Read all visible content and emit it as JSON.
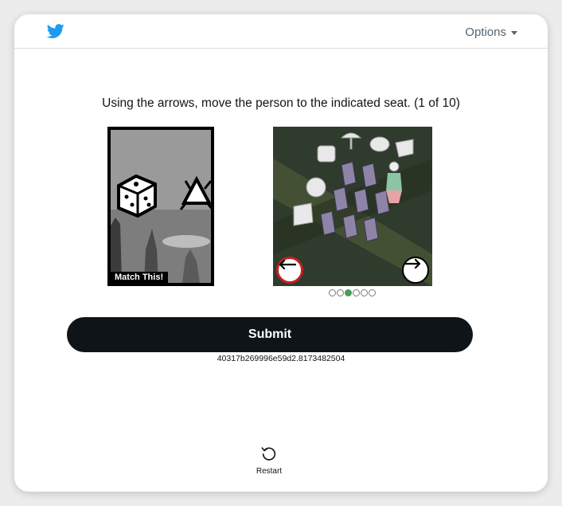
{
  "header": {
    "logo_icon": "twitter-bird-icon",
    "options_label": "Options"
  },
  "challenge": {
    "instruction": "Using the arrows, move the person to the indicated seat. (1 of 10)",
    "match_label": "Match This!",
    "progress": {
      "total": 6,
      "current": 3
    },
    "left_arrow_icon": "arrow-left-icon",
    "right_arrow_icon": "arrow-right-icon"
  },
  "actions": {
    "submit_label": "Submit",
    "session_id": "40317b269996e59d2.8173482504",
    "restart_label": "Restart"
  },
  "colors": {
    "brand": "#1d9bf0",
    "button_bg": "#0f1419",
    "progress_active": "#4a9a5c",
    "left_arrow_border": "#c3201f"
  }
}
